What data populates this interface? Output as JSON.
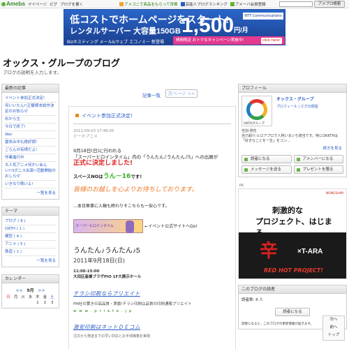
{
  "topbar": {
    "brand": "Ameba",
    "links": [
      "マイページ",
      "ピグ",
      "ブログを書く"
    ],
    "promo_1": "アメゴニで商品をもらって得費",
    "promo_2": "芸能人ブログランキング",
    "promo_3": "アメーバ会員登録",
    "search_button": "アメブロ検索"
  },
  "banner": {
    "line1": "低コストでホームページをスタート!",
    "line2": "レンタルサーバー 大容量150GB",
    "line3": "Bizホスティング メール&ウェブ エコノミー 新登場",
    "price": "1,500",
    "price_unit": "円/月",
    "sponsor": "NTT Communications",
    "campaign": "開間限定 おトクなキャンペーン実施中!",
    "click": "click here!"
  },
  "header": {
    "title": "オックス・グループのブログ",
    "description": "ブログの説明を入力します。"
  },
  "left": {
    "recent_title": "最新の記事",
    "recent_items": [
      "イベント参加正式決定!",
      "何いいたん!!正観様本総作決定のお知らせ",
      "右から生",
      "今日で終了!",
      "War",
      "夏休み中も絶好調!",
      "ごらんの有様だよ!",
      "作業進行中",
      "大人気アニメ何かいあんい!!3ボニス出演!!活動開始のおしらせ",
      "いきなり晩いよ!"
    ],
    "recent_more": "一覧を見る",
    "theme_title": "テーマ",
    "theme_items": [
      "ブログ ( 8 )",
      "OKTH ( 1 )",
      "模型 ( 4 )",
      "アニメ ( 5 )",
      "鉄道 ( 1 )"
    ],
    "theme_more": "一覧を見る",
    "calendar_title": "カレンダー",
    "calendar_prev": "<<",
    "calendar_month": "9月",
    "calendar_next": ">>",
    "calendar_days": [
      "日",
      "月",
      "火",
      "水",
      "木",
      "金",
      "土"
    ],
    "calendar_dates": [
      "",
      "",
      "",
      "",
      "1",
      "2",
      "3"
    ]
  },
  "main": {
    "article_list": "記事一覧",
    "next_page": "次ページ >>",
    "post_title": "イベント参加正式決定!",
    "post_date": "2011-09-03 17:46:05",
    "post_theme": "テーマ:アニメ",
    "p1": "9月18日(日)に行われる",
    "p2": "「スーパーヒロインタイム」内の「うんたん♪うんたん♪5」への出展が",
    "p3": "正式に決定しました!",
    "space_label": "スペースNOは",
    "space_no": "うん－16",
    "space_tail": "です!",
    "wait": "皆様のお越しを心よりお待ちしております。",
    "note": "…本日無事に入稿も終わりそこちらも一安心です。",
    "event_img": "スーパーヒロインタイム",
    "event_caption": "←イベント公式サイトへGo!",
    "event_name": "うんたん♪うんたん♪5",
    "event_date": "2011年9月18日(日)",
    "event_time": "11:00-15:00",
    "event_place": "大田区産業プラザPIO 1F大展示ホール",
    "ad1_title": "チラシ印刷ならプリエイト",
    "ad1_sub": "FM社の驚きの高品質・実績!チラシ印刷は品質の印刷通販プリエイト",
    "ad1_url": "w w w . p r i a t e . j p",
    "ad2_title": "激安印刷はネットＤＥコム",
    "ad2_sub": "注文から発送までの早い対応とお手頃価格を実現"
  },
  "right": {
    "profile_title": "プロフィール",
    "profile_name": "オックス・グループ",
    "profile_links": "プロフィール | ピグの部屋",
    "profile_img_caption": "OKTHグループ",
    "profile_gender": "性別:男性",
    "profile_desc": "自己紹介:ヒロアプロで人称いまいち適当です。特にOKKTHは「好きなことを一生」をコン...",
    "profile_more": "続きを見る",
    "btn_reader": "読者になる",
    "btn_amember": "アメンバーになる",
    "btn_message": "メッセージを送る",
    "btn_present": "プレゼントを贈る",
    "pr": "PR",
    "ad_line1": "刺激的な",
    "ad_line2": "プロジェクト、はじまる。",
    "ad_brand": "NONGSHIM",
    "ad_kara": "辛",
    "ad_tara": "×T-ARA",
    "ad_red": "RED HOT PROJECT!",
    "readers_title": "このブログの読者",
    "readers_count": "読者数: 8 人",
    "readers_btn": "読者になる",
    "readers_note": "読者になると、このブログの更新情報が届きます。"
  },
  "float": {
    "next": "次へ",
    "prev": "前へ",
    "top": "トップ"
  }
}
